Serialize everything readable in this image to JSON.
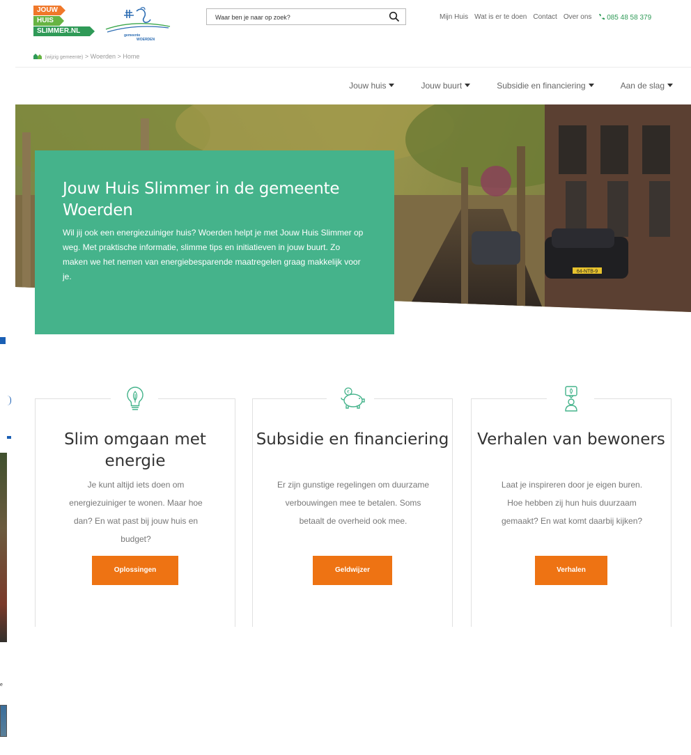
{
  "brand": {
    "logo_lines": [
      "JOUW",
      "HUIS",
      "SLIMMER.NL"
    ],
    "colors": {
      "accent_green": "#45b38b",
      "button_orange": "#ee7313",
      "logo_orange": "#f0782a",
      "logo_lightgreen": "#67b443",
      "logo_darkgreen": "#2f9a57"
    }
  },
  "municipality_logo": {
    "name_lines": [
      "gemeente",
      "WOERDEN"
    ]
  },
  "search": {
    "placeholder": "Waar ben je naar op zoek?",
    "icon": "search-icon"
  },
  "topnav": {
    "items": [
      "Mijn Huis",
      "Wat is er te doen",
      "Contact",
      "Over ons"
    ],
    "phone": "085 48 58 379",
    "phone_icon": "phone-icon"
  },
  "breadcrumb": {
    "change": "(wijzig gemeente)",
    "separator": ">",
    "items": [
      "Woerden",
      "Home"
    ]
  },
  "mainnav": {
    "items": [
      "Jouw huis",
      "Jouw buurt",
      "Subsidie en financiering",
      "Aan de slag"
    ]
  },
  "hero": {
    "title": "Jouw Huis Slimmer in de gemeente Woerden",
    "text": "Wil jij ook een energiezuiniger huis? Woerden helpt je met Jouw Huis Slimmer op weg. Met praktische informatie, slimme tips en initiatieven in jouw buurt. Zo maken we het nemen van energiebesparende maatregelen graag makkelijk voor je.",
    "plate": "64-NTB-9"
  },
  "cards": [
    {
      "icon": "lightbulb-icon",
      "title": "Slim omgaan met energie",
      "text": "Je kunt altijd iets doen om energiezuiniger te wonen. Maar hoe dan? En wat past bij jouw huis en budget?",
      "button": "Oplossingen"
    },
    {
      "icon": "piggy-bank-icon",
      "title": "Subsidie en financiering",
      "text": "Er zijn gunstige regelingen om duurzame verbouwingen mee te betalen. Soms betaalt de overheid ook mee.",
      "button": "Geldwijzer"
    },
    {
      "icon": "resident-icon",
      "title": "Verhalen van bewoners",
      "text": "Laat je inspireren door je eigen buren. Hoe hebben zij hun huis duurzaam gemaakt? En wat komt daarbij kijken?",
      "button": "Verhalen"
    }
  ],
  "left_strip": {
    "visible_text": "e"
  }
}
